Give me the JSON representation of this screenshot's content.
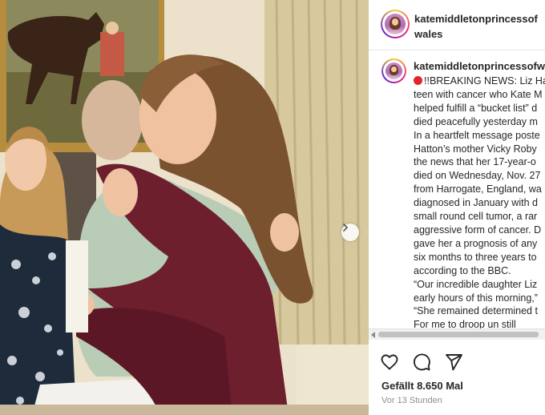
{
  "photo": {
    "alt_subject": "",
    "next_icon": "chevron-right-icon"
  },
  "header": {
    "username": "katemiddletonprincessofwales"
  },
  "caption": {
    "username": "katemiddletonprincessofwa",
    "lines": [
      "!!BREAKING NEWS: Liz Ha",
      "teen with cancer who Kate M",
      "helped fulfill a “bucket list” d",
      "died peacefully yesterday m",
      "In a heartfelt message poste",
      "Hatton’s mother Vicky Roby",
      "the news that her 17-year-o",
      "died on Wednesday, Nov. 27",
      "from Harrogate, England, wa",
      "diagnosed in January with d",
      "small round cell tumor, a rar",
      "aggressive form of cancer. D",
      "gave her a prognosis of any",
      "six months to three years to",
      "according to the BBC.",
      "“Our incredible daughter Liz",
      "early hours of this morning,”",
      "“She remained determined t",
      "For me to droop un still"
    ],
    "alert_icon": "red-circle-icon",
    "alert_color": "#e0262a"
  },
  "actions": {
    "like_icon": "heart-icon",
    "comment_icon": "comment-icon",
    "share_icon": "send-icon"
  },
  "likes_text": "Gefällt 8.650 Mal",
  "timestamp": "Vor 13 Stunden"
}
